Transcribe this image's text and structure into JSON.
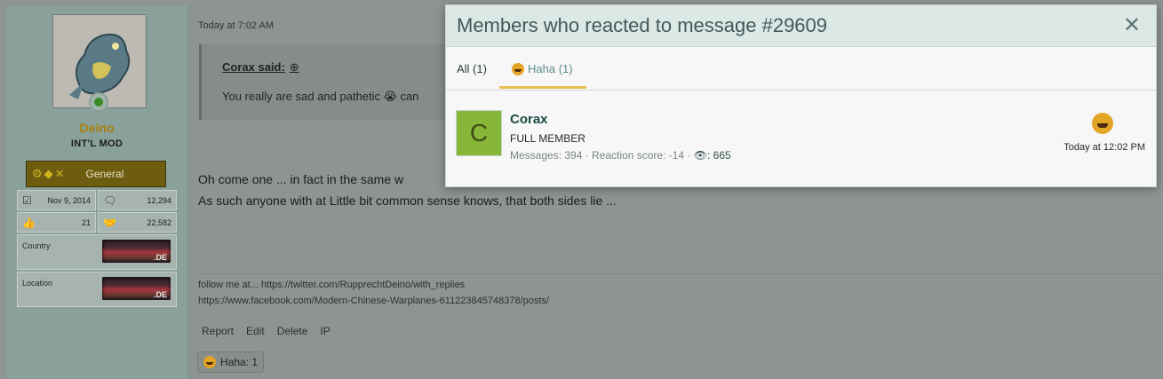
{
  "sidebar": {
    "username": "Deino",
    "user_title": "INT'L MOD",
    "banner_label": "General",
    "banner_symbols": "⚙◆✕",
    "stats": [
      {
        "icon": "calendar-icon",
        "value": "Nov 9, 2014"
      },
      {
        "icon": "messages-icon",
        "value": "12,294"
      },
      {
        "icon": "thumbs-up-icon",
        "value": "21"
      },
      {
        "icon": "handshake-icon",
        "value": "22,582"
      }
    ],
    "fields": [
      {
        "label": "Country",
        "flag_text": ".DE"
      },
      {
        "label": "Location",
        "flag_text": ".DE"
      }
    ]
  },
  "post": {
    "time": "Today at 7:02 AM",
    "quote_author": "Corax said:",
    "quote_arrow": "⊕",
    "quote_text": "You really are sad and pathetic 😭 can",
    "body_line1": "Oh come one ... in fact in the same w",
    "body_line1_tail": ",",
    "body_line2": "As such anyone with at Little bit common sense knows, that both sides lie ...",
    "signature_line1": "follow me at... https://twitter.com/RupprechtDeino/with_replies",
    "signature_line2": "https://www.facebook.com/Modern-Chinese-Warplanes-611223845748378/posts/",
    "actions": [
      "Report",
      "Edit",
      "Delete",
      "IP"
    ],
    "reaction_summary": "Haha: 1"
  },
  "modal": {
    "title": "Members who reacted to message #29609",
    "close": "✕",
    "tabs": [
      {
        "label": "All (1)"
      },
      {
        "label": "Haha (1)"
      }
    ],
    "member": {
      "initial": "C",
      "name": "Corax",
      "title": "FULL MEMBER",
      "stats_prefix": "Messages: 394 · Reaction score: -14 · ",
      "trophy_icon": "👁",
      "trophy_value": ": 665",
      "time": "Today at 12:02 PM"
    }
  }
}
